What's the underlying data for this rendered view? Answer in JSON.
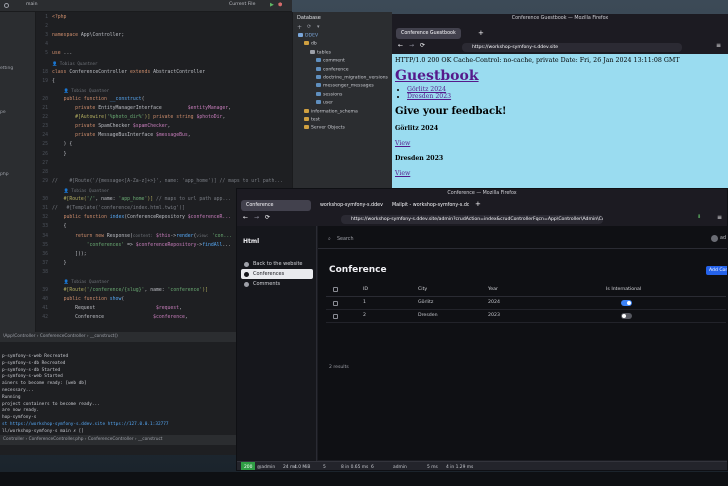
{
  "ide": {
    "branch": "main",
    "run_config": "Current File",
    "left_items": [
      "etting",
      "pe",
      "php"
    ],
    "code_lines": [
      {
        "n": "1",
        "html": "<span class='kw'>&lt;?php</span>"
      },
      {
        "n": "2",
        "html": ""
      },
      {
        "n": "3",
        "html": "<span class='kw'>namespace</span> App\\Controller;"
      },
      {
        "n": "4",
        "html": ""
      },
      {
        "n": "5",
        "html": "<span class='kw'>use</span> ..."
      },
      {
        "n": "",
        "html": "<span class='hint'>👤 Tobias Quantner</span>"
      },
      {
        "n": "18",
        "html": "<span class='kw'>class</span> ConferenceController <span class='kw'>extends</span> AbstractController"
      },
      {
        "n": "19",
        "html": "{"
      },
      {
        "n": "",
        "html": "&nbsp;&nbsp;&nbsp;&nbsp;<span class='hint'>👤 Tobias Quantner</span>"
      },
      {
        "n": "20",
        "html": "&nbsp;&nbsp;&nbsp;&nbsp;<span class='kw'>public function</span> <span class='fn'>__construct</span>("
      },
      {
        "n": "21",
        "html": "&nbsp;&nbsp;&nbsp;&nbsp;&nbsp;&nbsp;&nbsp;&nbsp;<span class='kw'>private</span> EntityManagerInterface &nbsp;&nbsp;&nbsp;&nbsp;&nbsp;&nbsp;&nbsp;&nbsp;<span class='vr'>$entityManager</span>,"
      },
      {
        "n": "22",
        "html": "&nbsp;&nbsp;&nbsp;&nbsp;&nbsp;&nbsp;&nbsp;&nbsp;<span class='an'>#[Autowire(</span><span class='st'>'%photo_dir%'</span><span class='an'>)]</span> <span class='kw'>private string</span> <span class='vr'>$photoDir</span>,"
      },
      {
        "n": "23",
        "html": "&nbsp;&nbsp;&nbsp;&nbsp;&nbsp;&nbsp;&nbsp;&nbsp;<span class='kw'>private</span> SpamChecker <span class='vr'>$spamChecker</span>,"
      },
      {
        "n": "24",
        "html": "&nbsp;&nbsp;&nbsp;&nbsp;&nbsp;&nbsp;&nbsp;&nbsp;<span class='kw'>private</span> MessageBusInterface <span class='vr'>$messageBus</span>,"
      },
      {
        "n": "25",
        "html": "&nbsp;&nbsp;&nbsp;&nbsp;) {"
      },
      {
        "n": "26",
        "html": "&nbsp;&nbsp;&nbsp;&nbsp;}"
      },
      {
        "n": "27",
        "html": ""
      },
      {
        "n": "28",
        "html": ""
      },
      {
        "n": "29",
        "html": "<span class='cm'>//&nbsp;&nbsp;&nbsp;&nbsp;#[Route('/{message<[A-Za-z]+>}', name: 'app_home')] // maps to url path...</span>"
      },
      {
        "n": "",
        "html": "&nbsp;&nbsp;&nbsp;&nbsp;<span class='hint'>👤 Tobias Quantner</span>"
      },
      {
        "n": "30",
        "html": "&nbsp;&nbsp;&nbsp;&nbsp;<span class='an'>#[Route(</span><span class='st'>'/'</span>, name: <span class='st'>'app_home'</span><span class='an'>)]</span> <span class='cm'>// maps to url path app...</span>"
      },
      {
        "n": "31",
        "html": "<span class='cm'>//&nbsp;&nbsp;&nbsp;#[Template('conference/index.html.twig')]</span>"
      },
      {
        "n": "32",
        "html": "&nbsp;&nbsp;&nbsp;&nbsp;<span class='kw'>public function</span> <span class='fn'>index</span>(ConferenceRepository <span class='vr'>$conferenceR...</span>"
      },
      {
        "n": "33",
        "html": "&nbsp;&nbsp;&nbsp;&nbsp;{"
      },
      {
        "n": "34",
        "html": "&nbsp;&nbsp;&nbsp;&nbsp;&nbsp;&nbsp;&nbsp;&nbsp;<span class='kw'>return new</span> Response(<span class='hint'>content:</span> <span class='vr'>$this</span>-><span class='fn'>render</span>(<span class='hint'>view:</span> <span class='st'>'con...</span>"
      },
      {
        "n": "35",
        "html": "&nbsp;&nbsp;&nbsp;&nbsp;&nbsp;&nbsp;&nbsp;&nbsp;&nbsp;&nbsp;&nbsp;&nbsp;<span class='st'>'conferences'</span> => <span class='vr'>$conferenceRepository</span>-><span class='fn'>findAll</span>..."
      },
      {
        "n": "36",
        "html": "&nbsp;&nbsp;&nbsp;&nbsp;&nbsp;&nbsp;&nbsp;&nbsp;]));"
      },
      {
        "n": "37",
        "html": "&nbsp;&nbsp;&nbsp;&nbsp;}"
      },
      {
        "n": "38",
        "html": ""
      },
      {
        "n": "",
        "html": "&nbsp;&nbsp;&nbsp;&nbsp;<span class='hint'>👤 Tobias Quantner</span>"
      },
      {
        "n": "39",
        "html": "&nbsp;&nbsp;&nbsp;&nbsp;<span class='an'>#[Route(</span><span class='st'>'/conference/{slug}'</span>, name: <span class='st'>'conference'</span><span class='an'>)]</span>"
      },
      {
        "n": "40",
        "html": "&nbsp;&nbsp;&nbsp;&nbsp;<span class='kw'>public function</span> <span class='fn'>show</span>("
      },
      {
        "n": "41",
        "html": "&nbsp;&nbsp;&nbsp;&nbsp;&nbsp;&nbsp;&nbsp;&nbsp;Request &nbsp;&nbsp;&nbsp;&nbsp;&nbsp;&nbsp;&nbsp;&nbsp;&nbsp;&nbsp;&nbsp;&nbsp;&nbsp;&nbsp;&nbsp;&nbsp;&nbsp;&nbsp;&nbsp;&nbsp;<span class='vr'>$request</span>,"
      },
      {
        "n": "42",
        "html": "&nbsp;&nbsp;&nbsp;&nbsp;&nbsp;&nbsp;&nbsp;&nbsp;Conference &nbsp;&nbsp;&nbsp;&nbsp;&nbsp;&nbsp;&nbsp;&nbsp;&nbsp;&nbsp;&nbsp;&nbsp;&nbsp;&nbsp;&nbsp;&nbsp;<span class='vr'>$conference</span>,"
      }
    ],
    "breadcrumb": "\\App\\Controller  ›  ConferenceController  ›  __construct()",
    "terminal_lines": [
      "p-symfony-s-web  Recreated",
      "p-symfony-s-db  Recreated",
      "p-symfony-s-db  Started",
      "p-symfony-s-web  Started",
      "ainers to become ready: [web db]",
      " necessary...",
      " Running",
      " project containers to become ready...",
      "are now ready.",
      "hop-symfony-s",
      "st  https://workshop-symfony-s.ddev.site  https://127.0.0.1:32777",
      "ll/workshop-symfony-s  main ✗ []"
    ],
    "status_crumb": "Controller  ›  ConferenceController.php  ›  ConferenceController  ›  __construct"
  },
  "db": {
    "title": "Database",
    "tree": [
      {
        "d": 0,
        "label": "DDEV",
        "c": "#7aa6da"
      },
      {
        "d": 1,
        "label": "db",
        "c": "#c8cad0"
      },
      {
        "d": 2,
        "label": "tables",
        "c": "#c8cad0"
      },
      {
        "d": 3,
        "label": "comment",
        "c": "#c8cad0"
      },
      {
        "d": 3,
        "label": "conference",
        "c": "#c8cad0"
      },
      {
        "d": 3,
        "label": "doctrine_migration_versions",
        "c": "#c8cad0"
      },
      {
        "d": 3,
        "label": "messenger_messages",
        "c": "#c8cad0"
      },
      {
        "d": 3,
        "label": "sessions",
        "c": "#c8cad0"
      },
      {
        "d": 3,
        "label": "user",
        "c": "#c8cad0"
      },
      {
        "d": 1,
        "label": "information_schema",
        "c": "#c8cad0"
      },
      {
        "d": 1,
        "label": "test",
        "c": "#c8cad0"
      },
      {
        "d": 1,
        "label": "Server Objects",
        "c": "#c8cad0"
      }
    ]
  },
  "guestbook_window": {
    "window_title": "Conference Guestbook — Mozilla Firefox",
    "tab_label": "Conference Guestbook",
    "url": "https://workshop-symfony-s.ddev.site",
    "http_header": "HTTP/1.0 200 OK Cache-Control: no-cache, private Date: Fri, 26 Jan 2024 13:11:08 GMT",
    "heading": "Guestbook",
    "links": [
      "Görlitz 2024",
      "Dresden 2023"
    ],
    "feedback_heading": "Give your feedback!",
    "sections": [
      {
        "title": "Görlitz 2024",
        "link": "View"
      },
      {
        "title": "Dresden 2023",
        "link": "View"
      }
    ]
  },
  "admin_window": {
    "window_title": "Conference — Mozilla Firefox",
    "tabs": [
      "Conference",
      "workshop-symfony-s.ddev.site",
      "Mailpit - workshop-symfony-s.ddev.site"
    ],
    "url": "https://workshop-symfony-s.ddev.site/admin?crudAction=index&crudControllerFqcn=App\\Controller\\Admin\\Confe...",
    "sidebar_title": "Html",
    "sidebar_items": [
      "Back to the website",
      "Conferences",
      "Comments"
    ],
    "search_placeholder": "Search",
    "user": "ad",
    "page_title": "Conference",
    "add_button": "Add Con",
    "columns": [
      "ID",
      "City",
      "Year",
      "Is International"
    ],
    "rows": [
      {
        "id": "1",
        "city": "Görlitz",
        "year": "2024",
        "intl": true
      },
      {
        "id": "2",
        "city": "Dresden",
        "year": "2023",
        "intl": false
      }
    ],
    "results": "2 results",
    "profiler": [
      "200",
      "@admin",
      "24 ms",
      "4.0 MiB",
      "5",
      "8 in 0.65 ms",
      "6",
      "admin",
      "5 ms",
      "4 in 1.29 ms"
    ]
  }
}
